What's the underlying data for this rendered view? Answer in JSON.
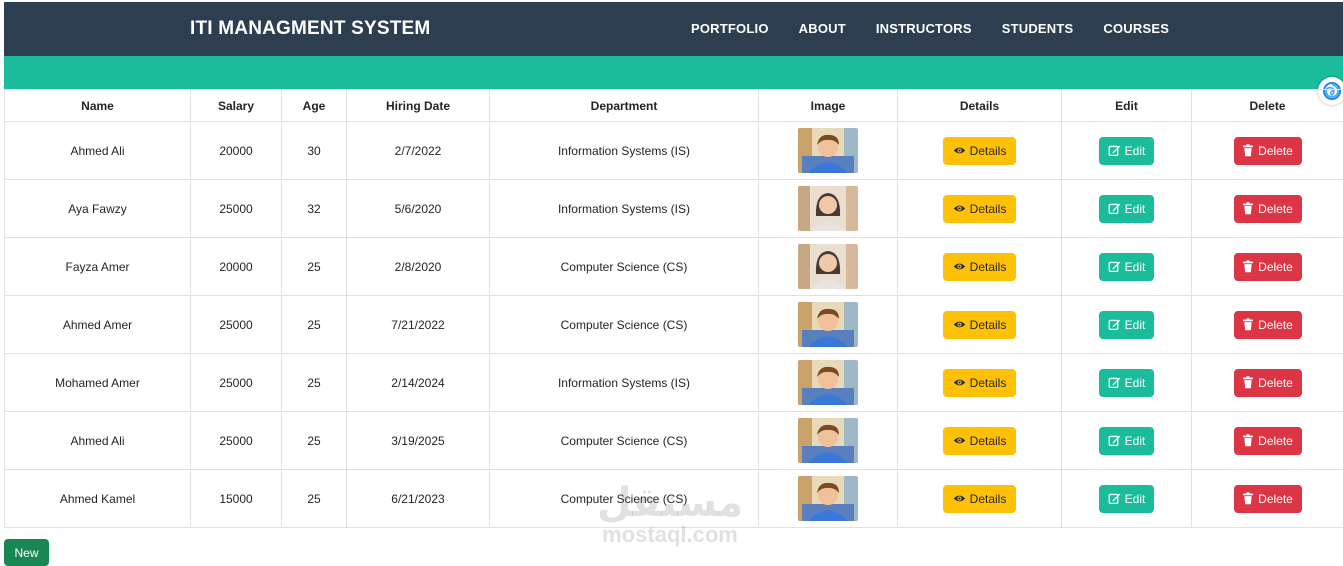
{
  "brand": "ITI MANAGMENT SYSTEM",
  "nav": [
    "PORTFOLIO",
    "ABOUT",
    "INSTRUCTORS",
    "STUDENTS",
    "COURSES"
  ],
  "table": {
    "headers": [
      "Name",
      "Salary",
      "Age",
      "Hiring Date",
      "Department",
      "Image",
      "Details",
      "Edit",
      "Delete"
    ],
    "rows": [
      {
        "name": "Ahmed Ali",
        "salary": "20000",
        "age": "30",
        "hiring_date": "2/7/2022",
        "department": "Information Systems (IS)",
        "avatar": "male-avatar"
      },
      {
        "name": "Aya Fawzy",
        "salary": "25000",
        "age": "32",
        "hiring_date": "5/6/2020",
        "department": "Information Systems (IS)",
        "avatar": "female-avatar"
      },
      {
        "name": "Fayza Amer",
        "salary": "20000",
        "age": "25",
        "hiring_date": "2/8/2020",
        "department": "Computer Science (CS)",
        "avatar": "female-avatar"
      },
      {
        "name": "Ahmed Amer",
        "salary": "25000",
        "age": "25",
        "hiring_date": "7/21/2022",
        "department": "Computer Science (CS)",
        "avatar": "male-avatar"
      },
      {
        "name": "Mohamed Amer",
        "salary": "25000",
        "age": "25",
        "hiring_date": "2/14/2024",
        "department": "Information Systems (IS)",
        "avatar": "male-avatar"
      },
      {
        "name": "Ahmed Ali",
        "salary": "25000",
        "age": "25",
        "hiring_date": "3/19/2025",
        "department": "Computer Science (CS)",
        "avatar": "male-avatar"
      },
      {
        "name": "Ahmed Kamel",
        "salary": "15000",
        "age": "25",
        "hiring_date": "6/21/2023",
        "department": "Computer Science (CS)",
        "avatar": "male-avatar"
      }
    ]
  },
  "buttons": {
    "details": "Details",
    "edit": "Edit",
    "delete": "Delete",
    "new": "New"
  },
  "icons": {
    "details": "eye-icon",
    "edit": "edit-icon",
    "delete": "trash-icon",
    "floating": "spiral-icon"
  },
  "watermark": {
    "arabic": "مستقل",
    "latin": "mostaql.com"
  },
  "colors": {
    "navbar": "#2c3e50",
    "teal": "#1abc9c",
    "details": "#ffc107",
    "edit": "#1abc9c",
    "delete": "#dc3545",
    "new": "#198754"
  }
}
